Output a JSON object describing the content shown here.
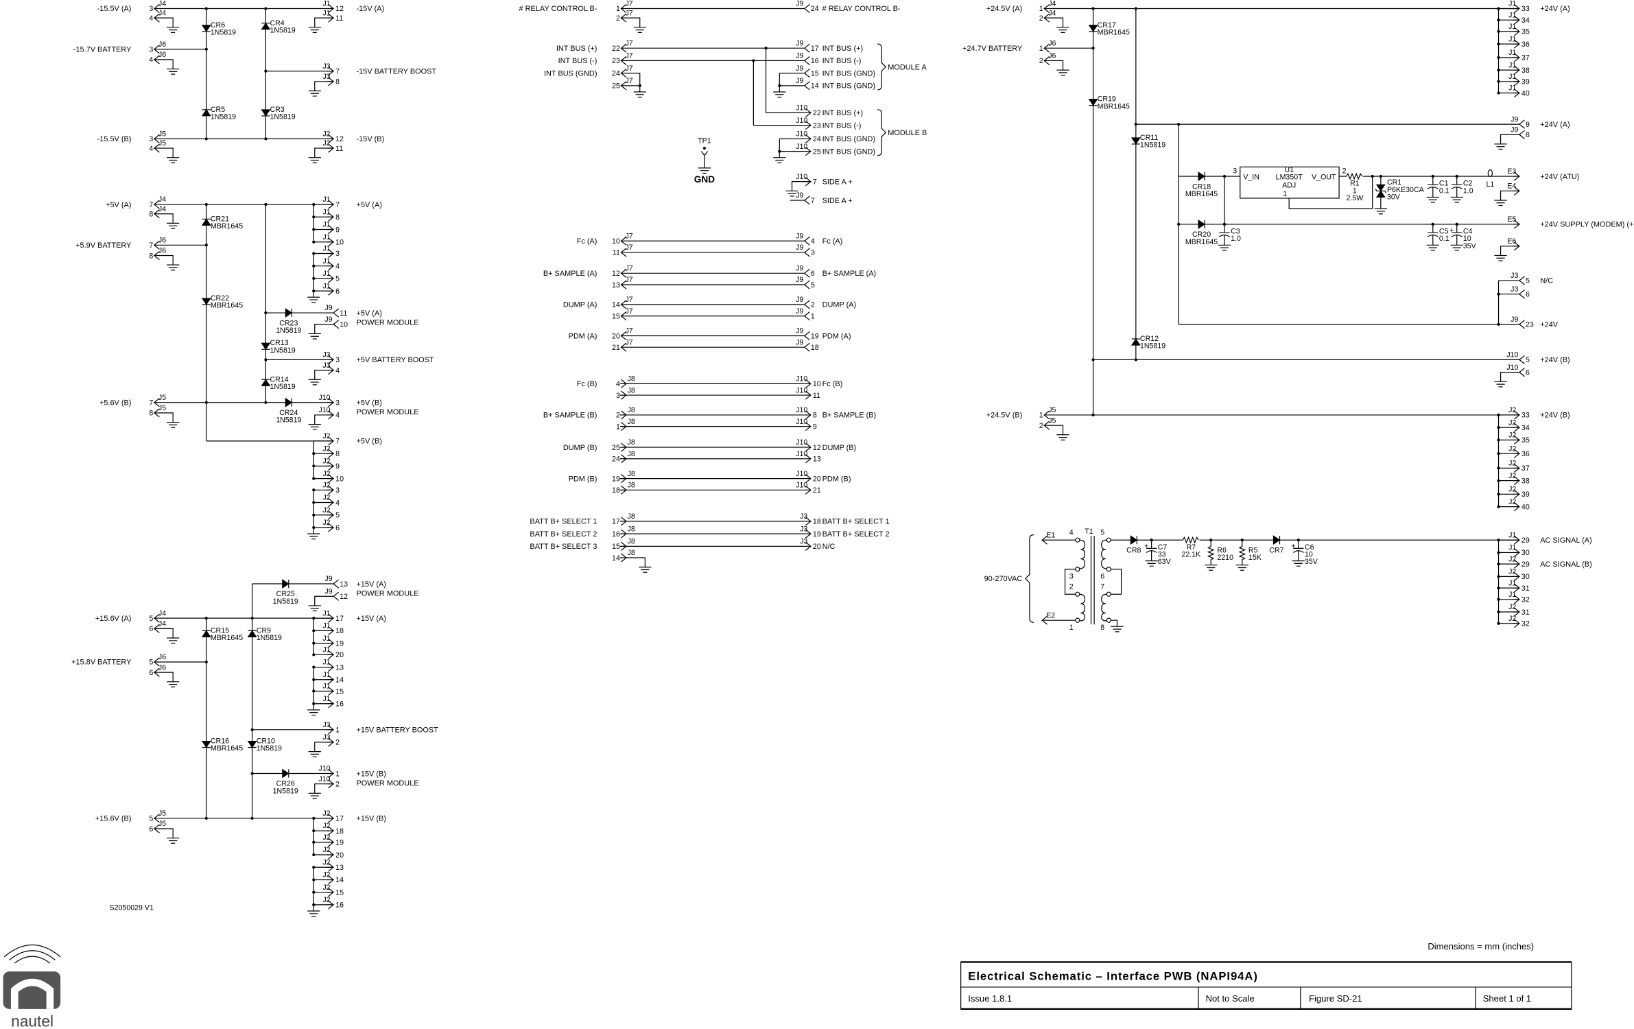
{
  "title_block": {
    "title": "Electrical Schematic – Interface PWB (NAPI94A)",
    "issue": "Issue 1.8.1",
    "scale": "Not to Scale",
    "figure": "Figure SD-21",
    "sheet": "Sheet 1 of 1",
    "dimensions_note": "Dimensions = mm (inches)"
  },
  "drawing_number": "S2050029  V1",
  "logo": {
    "text": "nautel"
  },
  "sections": {
    "neg15": {
      "nets": [
        "-15.5V (A)",
        "-15.7V BATTERY",
        "-15.5V (B)",
        "-15V (A)",
        "-15V BATTERY BOOST",
        "-15V (B)"
      ],
      "connectors": [
        [
          "J4",
          "3"
        ],
        [
          "J4",
          "4"
        ],
        [
          "J6",
          "3"
        ],
        [
          "J6",
          "4"
        ],
        [
          "J5",
          "3"
        ],
        [
          "J5",
          "4"
        ],
        [
          "J1",
          "12"
        ],
        [
          "J1",
          "11"
        ],
        [
          "J3",
          "7"
        ],
        [
          "J3",
          "8"
        ],
        [
          "J2",
          "12"
        ],
        [
          "J2",
          "11"
        ]
      ],
      "parts": [
        [
          "CR6",
          "1N5819"
        ],
        [
          "CR4",
          "1N5819"
        ],
        [
          "CR5",
          "1N5819"
        ],
        [
          "CR3",
          "1N5819"
        ]
      ]
    },
    "pos5": {
      "nets": [
        "+5V (A)",
        "+5.9V BATTERY",
        "+5.6V (B)",
        "+5V (A)",
        "+5V (A)",
        "POWER MODULE",
        "+5V BATTERY BOOST",
        "+5V (B)",
        "POWER MODULE",
        "+5V (B)"
      ],
      "connectors": [
        [
          "J4",
          "7"
        ],
        [
          "J4",
          "8"
        ],
        [
          "J6",
          "7"
        ],
        [
          "J6",
          "8"
        ],
        [
          "J5",
          "7"
        ],
        [
          "J5",
          "8"
        ],
        [
          "J1",
          "7"
        ],
        [
          "J1",
          "8"
        ],
        [
          "J1",
          "9"
        ],
        [
          "J1",
          "10"
        ],
        [
          "J1",
          "3"
        ],
        [
          "J1",
          "4"
        ],
        [
          "J1",
          "5"
        ],
        [
          "J1",
          "6"
        ],
        [
          "J9",
          "11"
        ],
        [
          "J9",
          "10"
        ],
        [
          "J3",
          "3"
        ],
        [
          "J3",
          "4"
        ],
        [
          "J10",
          "3"
        ],
        [
          "J10",
          "4"
        ],
        [
          "J2",
          "7"
        ],
        [
          "J2",
          "8"
        ],
        [
          "J2",
          "9"
        ],
        [
          "J2",
          "10"
        ],
        [
          "J2",
          "3"
        ],
        [
          "J2",
          "4"
        ],
        [
          "J2",
          "5"
        ],
        [
          "J2",
          "6"
        ]
      ],
      "parts": [
        [
          "CR21",
          "MBR1645"
        ],
        [
          "CR22",
          "MBR1645"
        ],
        [
          "CR23",
          "1N5819"
        ],
        [
          "CR13",
          "1N5819"
        ],
        [
          "CR14",
          "1N5819"
        ],
        [
          "CR24",
          "1N5819"
        ]
      ]
    },
    "pos15": {
      "nets": [
        "+15.6V (A)",
        "+15.8V BATTERY",
        "+15.6V (B)",
        "+15V (A)",
        "POWER MODULE",
        "+15V (A)",
        "+15V BATTERY BOOST",
        "+15V (B)",
        "POWER MODULE",
        "+15V (B)"
      ],
      "connectors": [
        [
          "J4",
          "5"
        ],
        [
          "J4",
          "6"
        ],
        [
          "J6",
          "5"
        ],
        [
          "J6",
          "6"
        ],
        [
          "J5",
          "5"
        ],
        [
          "J5",
          "6"
        ],
        [
          "J9",
          "13"
        ],
        [
          "J9",
          "12"
        ],
        [
          "J1",
          "17"
        ],
        [
          "J1",
          "18"
        ],
        [
          "J1",
          "19"
        ],
        [
          "J1",
          "20"
        ],
        [
          "J1",
          "13"
        ],
        [
          "J1",
          "14"
        ],
        [
          "J1",
          "15"
        ],
        [
          "J1",
          "16"
        ],
        [
          "J3",
          "1"
        ],
        [
          "J3",
          "2"
        ],
        [
          "J10",
          "1"
        ],
        [
          "J10",
          "2"
        ],
        [
          "J2",
          "17"
        ],
        [
          "J2",
          "18"
        ],
        [
          "J2",
          "19"
        ],
        [
          "J2",
          "20"
        ],
        [
          "J2",
          "13"
        ],
        [
          "J2",
          "14"
        ],
        [
          "J2",
          "15"
        ],
        [
          "J2",
          "16"
        ]
      ],
      "parts": [
        [
          "CR15",
          "MBR1645"
        ],
        [
          "CR9",
          "1N5819"
        ],
        [
          "CR16",
          "MBR1645"
        ],
        [
          "CR10",
          "1N5819"
        ],
        [
          "CR25",
          "1N5819"
        ],
        [
          "CR26",
          "1N5819"
        ]
      ]
    },
    "mid": {
      "nets_left": [
        "# RELAY CONTROL B-",
        "INT BUS (+)",
        "INT BUS (-)",
        "INT BUS (GND)",
        "Fc (A)",
        "B+ SAMPLE (A)",
        "DUMP (A)",
        "PDM (A)",
        "Fc (B)",
        "B+ SAMPLE (B)",
        "DUMP (B)",
        "PDM (B)",
        "BATT B+ SELECT 1",
        "BATT B+ SELECT 2",
        "BATT B+ SELECT 3"
      ],
      "nets_right": [
        "# RELAY CONTROL B-",
        "INT BUS (+)",
        "INT BUS (-)",
        "INT BUS (GND)",
        "INT BUS (GND)",
        "INT BUS (+)",
        "INT BUS (-)",
        "INT BUS (GND)",
        "INT BUS (GND)",
        "SIDE A +",
        "SIDE A +",
        "Fc (A)",
        "B+ SAMPLE (A)",
        "DUMP (A)",
        "PDM (A)",
        "Fc (B)",
        "B+ SAMPLE (B)",
        "DUMP (B)",
        "PDM (B)",
        "BATT B+ SELECT 1",
        "BATT B+ SELECT 2",
        "N/C"
      ],
      "groups": [
        "MODULE A",
        "MODULE B"
      ],
      "testpoint": {
        "ref": "TP1",
        "label": "GND"
      },
      "connectors": [
        [
          "J7",
          "1"
        ],
        [
          "J7",
          "2"
        ],
        [
          "J7",
          "22"
        ],
        [
          "J7",
          "23"
        ],
        [
          "J7",
          "24"
        ],
        [
          "J7",
          "25"
        ],
        [
          "J9",
          "24"
        ],
        [
          "J9",
          "17"
        ],
        [
          "J9",
          "16"
        ],
        [
          "J9",
          "15"
        ],
        [
          "J9",
          "14"
        ],
        [
          "J10",
          "22"
        ],
        [
          "J10",
          "23"
        ],
        [
          "J10",
          "24"
        ],
        [
          "J10",
          "25"
        ],
        [
          "J10",
          "7"
        ],
        [
          "J9",
          "7"
        ],
        [
          "J7",
          "10"
        ],
        [
          "J7",
          "11"
        ],
        [
          "J9",
          "4"
        ],
        [
          "J9",
          "3"
        ],
        [
          "J7",
          "12"
        ],
        [
          "J7",
          "13"
        ],
        [
          "J9",
          "6"
        ],
        [
          "J9",
          "5"
        ],
        [
          "J7",
          "14"
        ],
        [
          "J7",
          "15"
        ],
        [
          "J9",
          "2"
        ],
        [
          "J9",
          "1"
        ],
        [
          "J7",
          "20"
        ],
        [
          "J7",
          "21"
        ],
        [
          "J9",
          "19"
        ],
        [
          "J9",
          "18"
        ],
        [
          "J8",
          "4"
        ],
        [
          "J8",
          "3"
        ],
        [
          "J10",
          "10"
        ],
        [
          "J10",
          "11"
        ],
        [
          "J8",
          "2"
        ],
        [
          "J8",
          "1"
        ],
        [
          "J10",
          "8"
        ],
        [
          "J10",
          "9"
        ],
        [
          "J8",
          "25"
        ],
        [
          "J8",
          "24"
        ],
        [
          "J10",
          "12"
        ],
        [
          "J10",
          "13"
        ],
        [
          "J8",
          "19"
        ],
        [
          "J8",
          "18"
        ],
        [
          "J10",
          "20"
        ],
        [
          "J10",
          "21"
        ],
        [
          "J8",
          "17"
        ],
        [
          "J8",
          "16"
        ],
        [
          "J8",
          "15"
        ],
        [
          "J8",
          "14"
        ],
        [
          "J3",
          "18"
        ],
        [
          "J3",
          "19"
        ],
        [
          "J3",
          "20"
        ]
      ]
    },
    "pos24": {
      "nets": [
        "+24.5V (A)",
        "+24.7V BATTERY",
        "+24.5V (B)",
        "+24V (A)",
        "+24V (A)",
        "+24V (ATU)",
        "+24V SUPPLY (MODEM) (+)",
        "N/C",
        "+24V",
        "+24V (B)",
        "+24V (B)"
      ],
      "connectors": [
        [
          "J4",
          "1"
        ],
        [
          "J4",
          "2"
        ],
        [
          "J6",
          "1"
        ],
        [
          "J6",
          "2"
        ],
        [
          "J5",
          "1"
        ],
        [
          "J5",
          "2"
        ],
        [
          "J1",
          "33"
        ],
        [
          "J1",
          "34"
        ],
        [
          "J1",
          "35"
        ],
        [
          "J1",
          "36"
        ],
        [
          "J1",
          "37"
        ],
        [
          "J1",
          "38"
        ],
        [
          "J1",
          "39"
        ],
        [
          "J1",
          "40"
        ],
        [
          "J9",
          "9"
        ],
        [
          "J9",
          "8"
        ],
        [
          "E3",
          ""
        ],
        [
          "E4",
          ""
        ],
        [
          "E5",
          ""
        ],
        [
          "E6",
          ""
        ],
        [
          "J3",
          "5"
        ],
        [
          "J3",
          "6"
        ],
        [
          "J9",
          "23"
        ],
        [
          "J10",
          "5"
        ],
        [
          "J10",
          "6"
        ],
        [
          "J2",
          "33"
        ],
        [
          "J2",
          "34"
        ],
        [
          "J2",
          "35"
        ],
        [
          "J2",
          "36"
        ],
        [
          "J2",
          "37"
        ],
        [
          "J2",
          "38"
        ],
        [
          "J2",
          "39"
        ],
        [
          "J2",
          "40"
        ]
      ],
      "parts": [
        [
          "CR17",
          "MBR1645"
        ],
        [
          "CR19",
          "MBR1645"
        ],
        [
          "CR11",
          "1N5819"
        ],
        [
          "CR12",
          "1N5819"
        ],
        [
          "CR18",
          "MBR1645"
        ],
        [
          "CR20",
          "MBR1645"
        ],
        [
          "CR1",
          "P6KE30CA",
          "30V"
        ],
        [
          "C1",
          "0.1"
        ],
        [
          "C2",
          "1.0"
        ],
        [
          "C3",
          "1.0"
        ],
        [
          "C5",
          "0.1"
        ],
        [
          "C4",
          "10",
          "35V"
        ],
        [
          "R1",
          "1",
          "2.5W"
        ],
        [
          "L1"
        ]
      ],
      "regulator": {
        "ref": "U1",
        "part": "LM350T",
        "pin_in": "V_IN",
        "pin_out": "V_OUT",
        "pin_adj": "ADJ",
        "pin_numbers": [
          "3",
          "2",
          "1"
        ]
      }
    },
    "ac": {
      "nets": [
        "90-270VAC",
        "AC SIGNAL (A)",
        "AC SIGNAL (B)"
      ],
      "connectors": [
        [
          "E1",
          ""
        ],
        [
          "E2",
          ""
        ],
        [
          "J1",
          "29"
        ],
        [
          "J1",
          "30"
        ],
        [
          "J2",
          "29"
        ],
        [
          "J2",
          "30"
        ],
        [
          "J1",
          "31"
        ],
        [
          "J1",
          "32"
        ],
        [
          "J2",
          "31"
        ],
        [
          "J2",
          "32"
        ]
      ],
      "transformer": {
        "ref": "T1",
        "pins": [
          "4",
          "3",
          "2",
          "1",
          "5",
          "6",
          "7",
          "8"
        ]
      },
      "parts": [
        [
          "CR8"
        ],
        [
          "C7",
          "33",
          "63V"
        ],
        [
          "R7",
          "22.1K"
        ],
        [
          "R6",
          "2210"
        ],
        [
          "R5",
          "15K"
        ],
        [
          "CR7"
        ],
        [
          "C6",
          "10",
          "35V"
        ]
      ]
    }
  }
}
